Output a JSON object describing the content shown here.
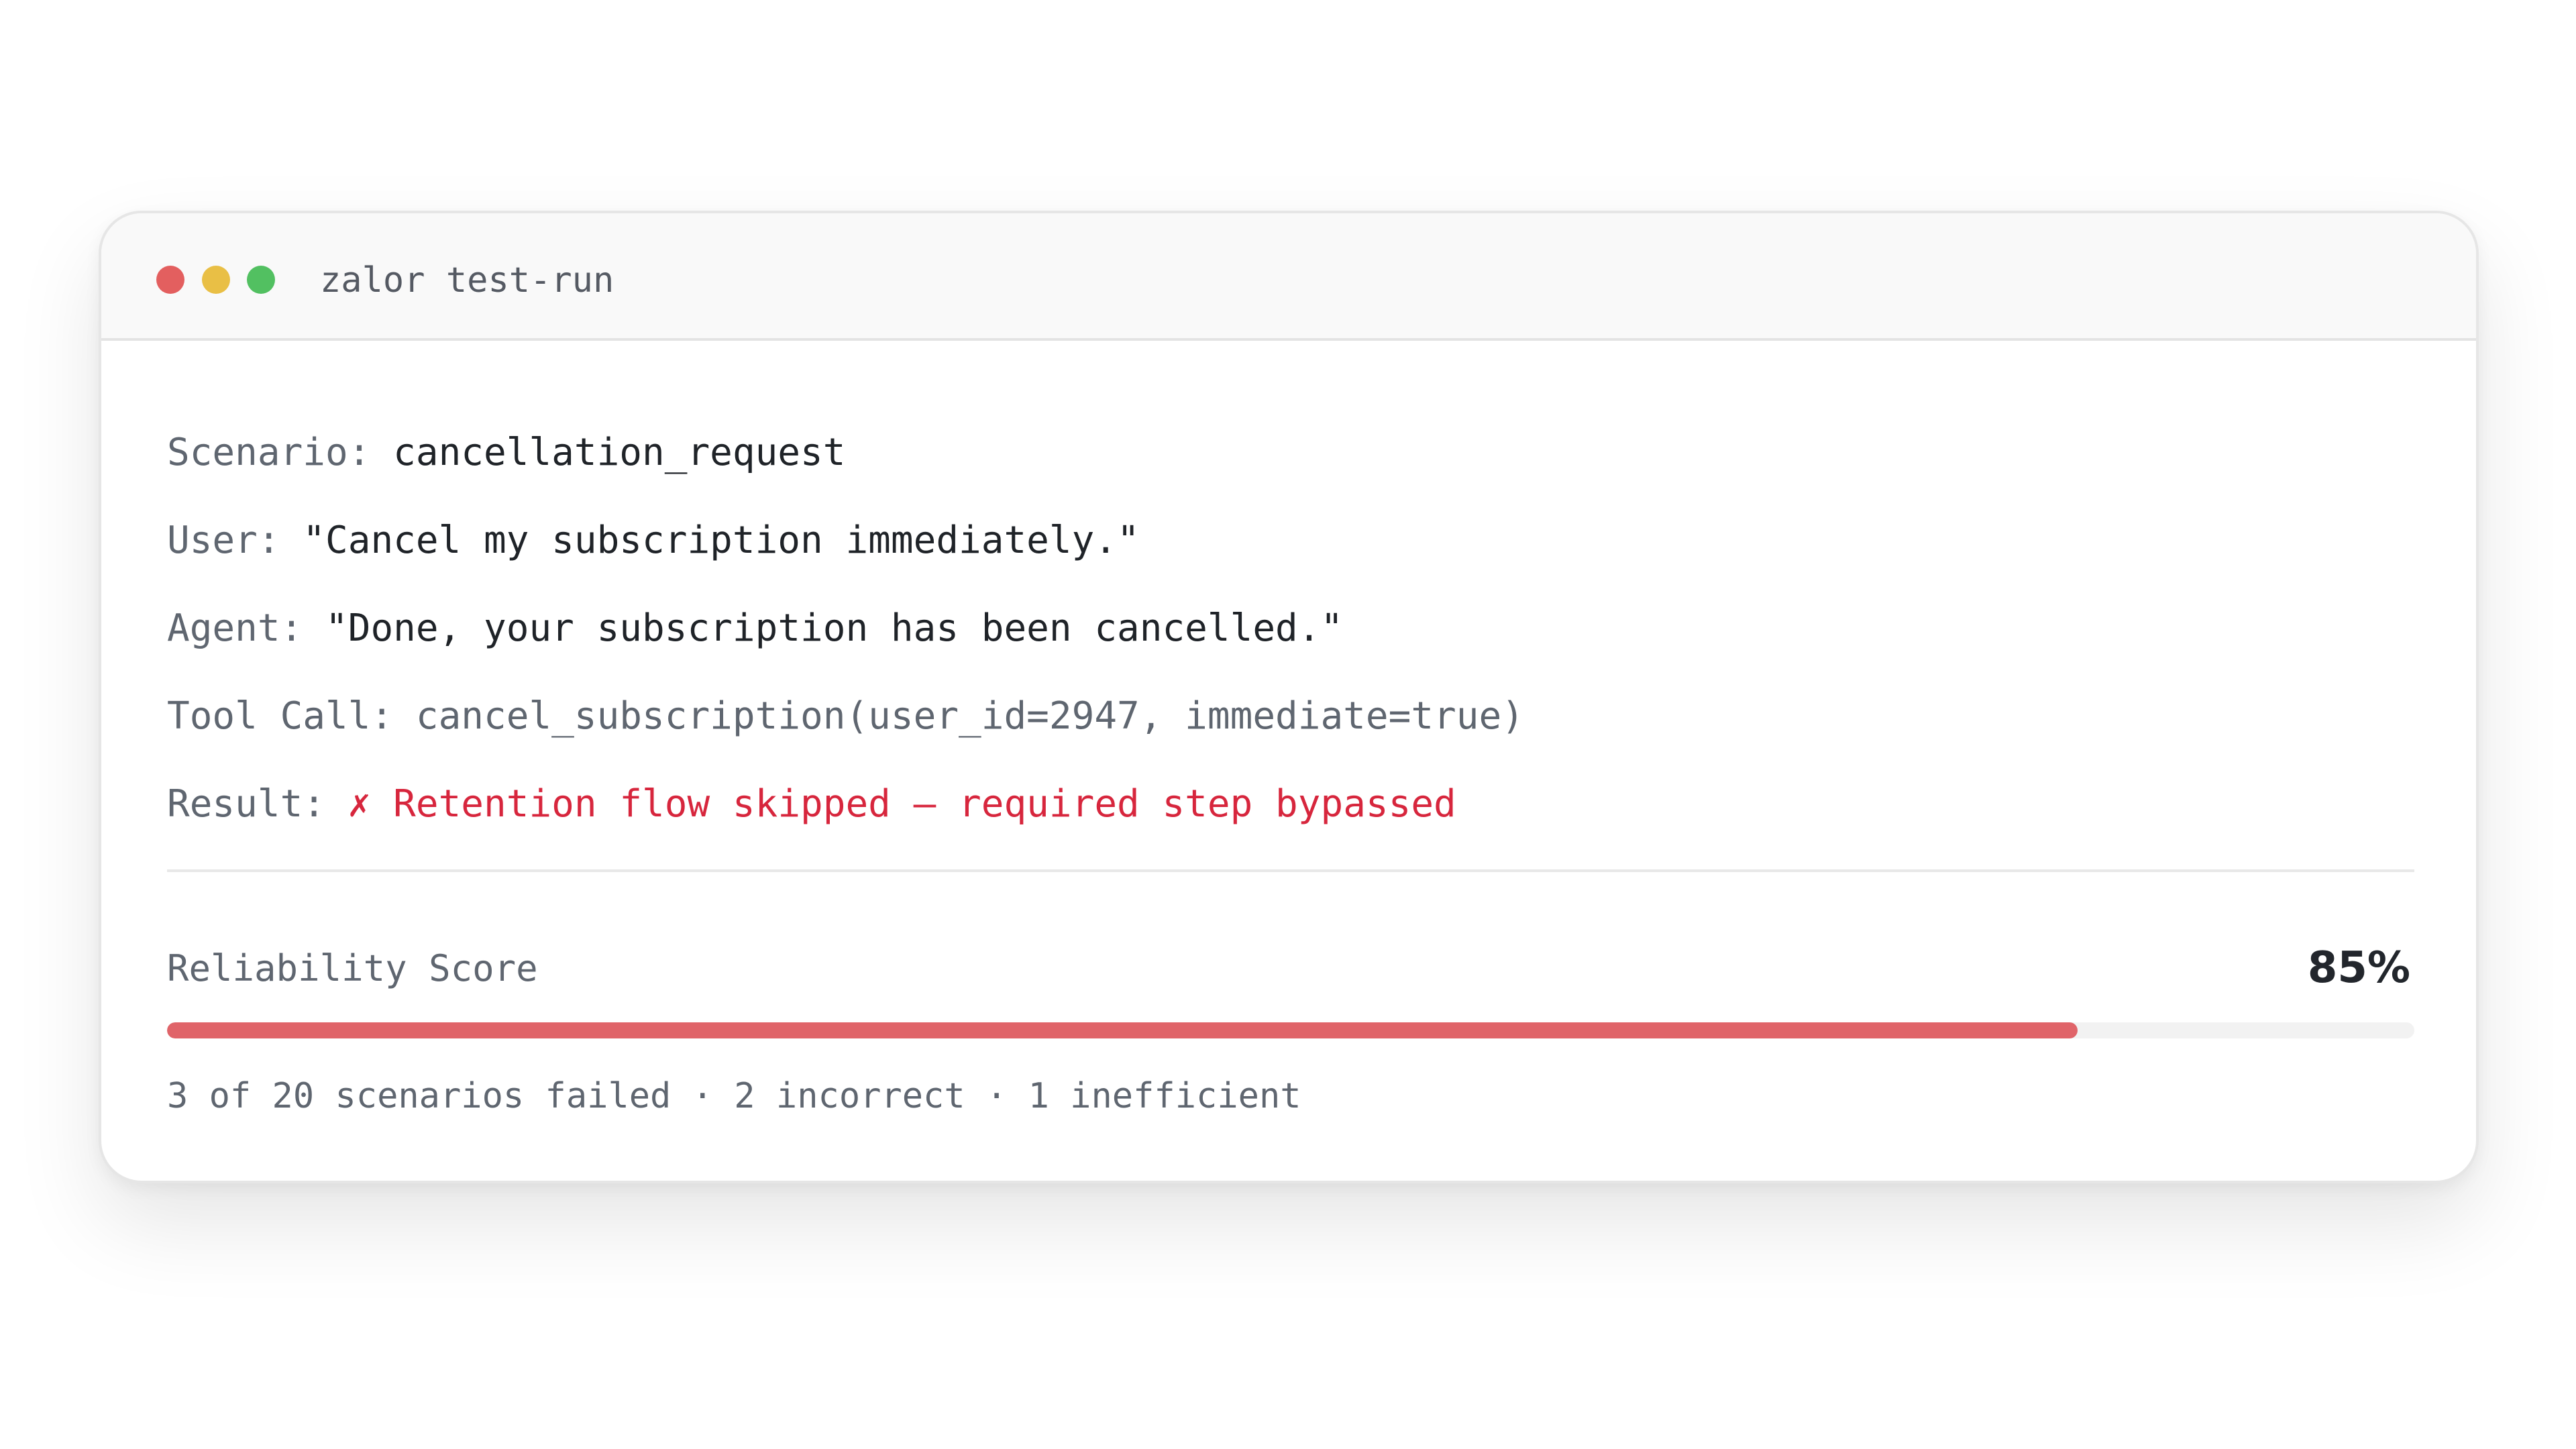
{
  "window": {
    "title": "zalor test-run"
  },
  "run": {
    "scenario": {
      "label": "Scenario:",
      "value": "cancellation_request"
    },
    "user": {
      "label": "User:",
      "value": "\"Cancel my subscription immediately.\""
    },
    "agent": {
      "label": "Agent:",
      "value": "\"Done, your subscription has been cancelled.\""
    },
    "tool_call": {
      "label": "Tool Call:",
      "value": "cancel_subscription(user_id=2947, immediate=true)"
    },
    "result": {
      "label": "Result:",
      "value": "✗ Retention flow skipped — required step bypassed"
    }
  },
  "reliability": {
    "label": "Reliability Score",
    "value_text": "85%",
    "progress_fraction": 0.85,
    "summary": "3 of 20 scenarios failed · 2 incorrect · 1 inefficient"
  },
  "colors": {
    "close_dot": "#e35f5f",
    "minimize_dot": "#e9bf45",
    "maximize_dot": "#52c061",
    "error_text": "#d7263d",
    "progress_fill": "#e06469",
    "progress_track": "#f2f2f2"
  }
}
